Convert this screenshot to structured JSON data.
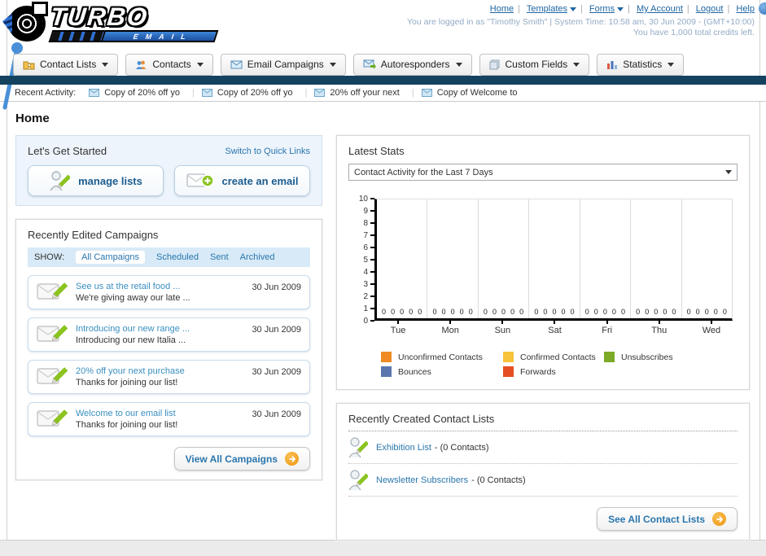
{
  "header": {
    "logo": {
      "title": "TURBO",
      "subtitle": "EMAIL"
    },
    "nav": [
      {
        "label": "Home",
        "dropdown": false
      },
      {
        "label": "Templates",
        "dropdown": true
      },
      {
        "label": "Forms",
        "dropdown": true
      },
      {
        "label": "My Account",
        "dropdown": false
      },
      {
        "label": "Logout",
        "dropdown": false
      },
      {
        "label": "Help",
        "dropdown": false
      }
    ],
    "login_info": "You are logged in as \"Timothy Smith\" | System Time: 10:58 am, 30 Jun 2009 - (GMT+10:00)",
    "credits_info": "You have 1,000 total credits left."
  },
  "nav_tabs": [
    {
      "label": "Contact Lists",
      "icon": "contact-lists-folder-icon"
    },
    {
      "label": "Contacts",
      "icon": "contacts-people-icon"
    },
    {
      "label": "Email Campaigns",
      "icon": "envelope-icon"
    },
    {
      "label": "Autoresponders",
      "icon": "autoresponder-envelope-icon"
    },
    {
      "label": "Custom Fields",
      "icon": "stacked-pages-icon"
    },
    {
      "label": "Statistics",
      "icon": "bar-chart-icon"
    }
  ],
  "recent_activity": {
    "label": "Recent Activity:",
    "items": [
      "Copy of 20% off yo",
      "Copy of 20% off yo",
      "20% off your next ",
      "Copy of Welcome to"
    ]
  },
  "page_title": "Home",
  "get_started": {
    "title": "Let's Get Started",
    "switch_link": "Switch to Quick Links",
    "buttons": [
      {
        "label": "manage lists",
        "icon": "person-pencil-icon"
      },
      {
        "label": "create an email",
        "icon": "envelope-plus-icon"
      }
    ]
  },
  "campaigns": {
    "title": "Recently Edited Campaigns",
    "show_label": "SHOW:",
    "filters": [
      "All Campaigns",
      "Scheduled",
      "Sent",
      "Archived"
    ],
    "active_filter": "All Campaigns",
    "items": [
      {
        "title": "See us at the retail food ...",
        "subtitle": "We're giving away our late ...",
        "date": "30 Jun 2009"
      },
      {
        "title": "Introducing our new range ...",
        "subtitle": "Introducing our new Italia ...",
        "date": "30 Jun 2009"
      },
      {
        "title": "20% off your next purchase",
        "subtitle": "Thanks for joining our list!",
        "date": "30 Jun 2009"
      },
      {
        "title": "Welcome to our email list",
        "subtitle": "Thanks for joining our list!",
        "date": "30 Jun 2009"
      }
    ],
    "view_all_label": "View All Campaigns"
  },
  "stats": {
    "title": "Latest Stats",
    "period_selected": "Contact Activity for the Last 7 Days"
  },
  "contact_lists": {
    "title": "Recently Created Contact Lists",
    "items": [
      {
        "name": "Exhibition List",
        "detail": "- (0 Contacts)"
      },
      {
        "name": "Newsletter Subscribers",
        "detail": "- (0 Contacts)"
      }
    ],
    "see_all_label": "See All Contact Lists"
  },
  "colors": {
    "navy_bar": "#14425f",
    "link_blue": "#1f66a3",
    "accent_orange": "#ef9413",
    "panel_blue_bg": "#edf4fb"
  },
  "chart_data": {
    "type": "bar",
    "title": "Contact Activity for the Last 7 Days",
    "categories": [
      "Tue",
      "Mon",
      "Sun",
      "Sat",
      "Fri",
      "Thu",
      "Wed"
    ],
    "series": [
      {
        "name": "Unconfirmed Contacts",
        "color": "#f08a24",
        "values": [
          0,
          0,
          0,
          0,
          0,
          0,
          0
        ]
      },
      {
        "name": "Confirmed Contacts",
        "color": "#f6c33a",
        "values": [
          0,
          0,
          0,
          0,
          0,
          0,
          0
        ]
      },
      {
        "name": "Unsubscribes",
        "color": "#7daa28",
        "values": [
          0,
          0,
          0,
          0,
          0,
          0,
          0
        ]
      },
      {
        "name": "Bounces",
        "color": "#5b76ae",
        "values": [
          0,
          0,
          0,
          0,
          0,
          0,
          0
        ]
      },
      {
        "name": "Forwards",
        "color": "#e54e22",
        "values": [
          0,
          0,
          0,
          0,
          0,
          0,
          0
        ]
      }
    ],
    "ylim": [
      0,
      10
    ],
    "y_ticks": [
      0,
      1,
      2,
      3,
      4,
      5,
      6,
      7,
      8,
      9,
      10
    ],
    "grid": "vertical group separators only",
    "legend_position": "bottom",
    "value_labels": "each bar shows its value (0) above the baseline"
  }
}
